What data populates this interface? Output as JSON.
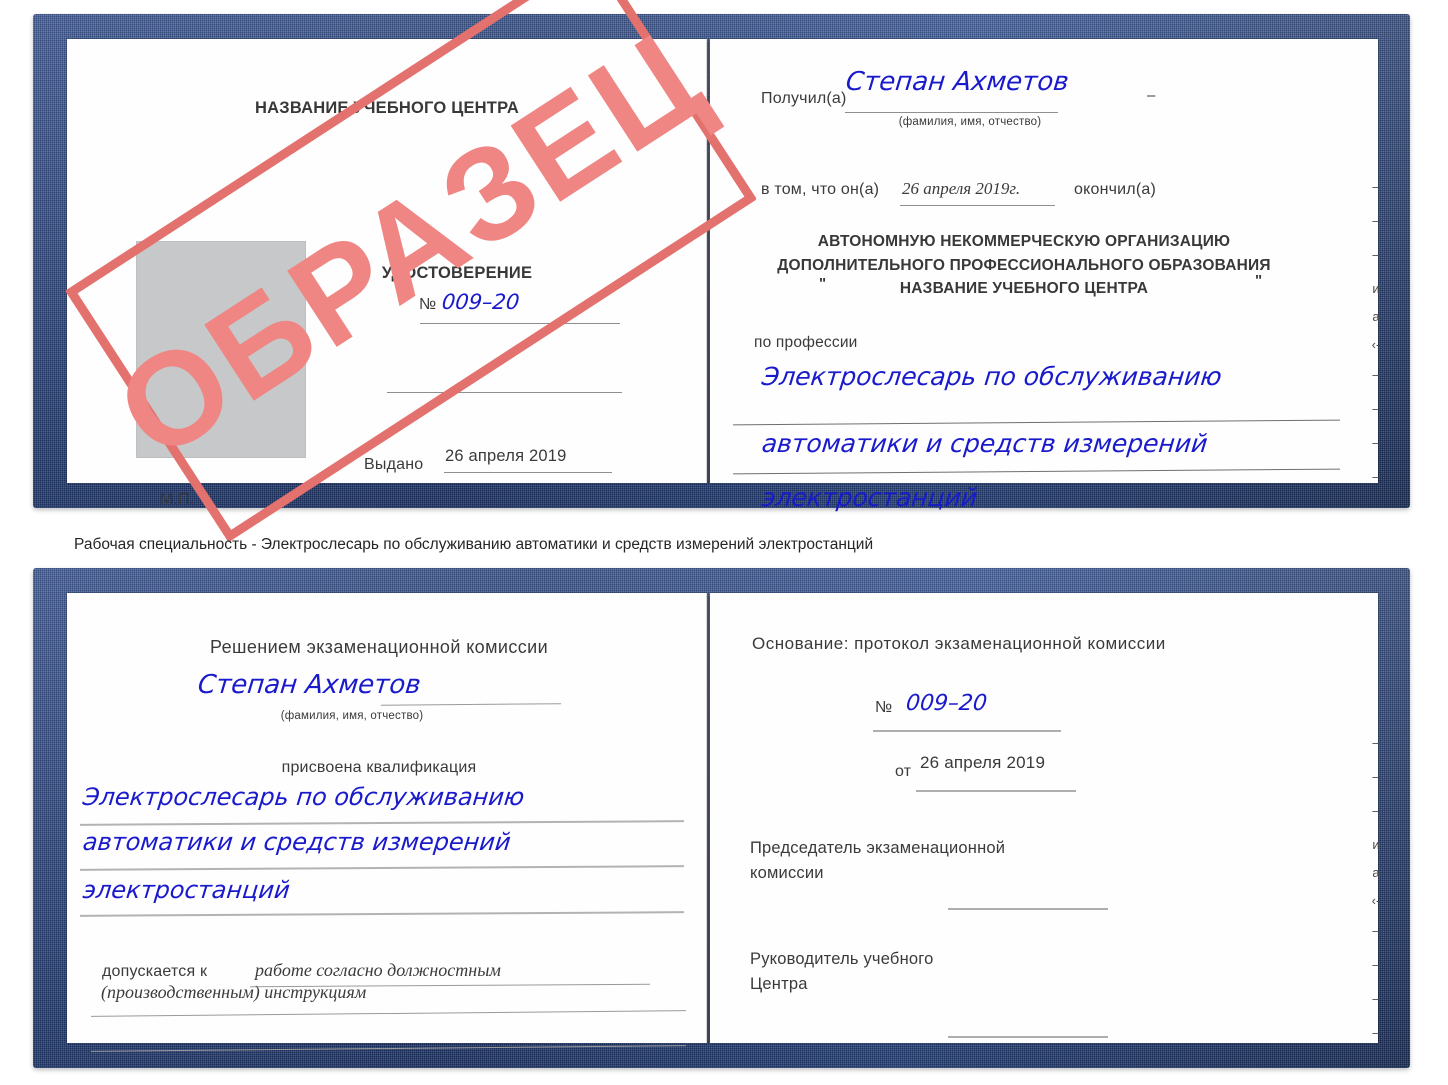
{
  "caption": {
    "text": "Рабочая специальность - Электрослесарь по обслуживанию автоматики и средств измерений электростанций"
  },
  "stamp": {
    "label": "ОБРАЗЕЦ",
    "color": "#ef8683",
    "border_color": "#e3716d"
  },
  "colors": {
    "cover_blue": "#2b4a8e",
    "handwriting_blue": "#1a1acd",
    "paper": "#fefefe",
    "photo_placeholder": "#c6c8c9",
    "text_gray": "#3a3a3a"
  },
  "certificate_top": {
    "left_page": {
      "heading": "НАЗВАНИЕ УЧЕБНОГО ЦЕНТРА",
      "doc_title": "УДОСТОВЕРЕНИЕ",
      "number_label": "№",
      "number_value": "009–20",
      "issued_label": "Выдано",
      "issued_value": "26 апреля 2019",
      "seal_label": "М.П."
    },
    "right_page": {
      "received_label": "Получил(а)",
      "received_value": "Степан Ахметов",
      "name_hint": "(фамилия, имя, отчество)",
      "that_he_label": "в том, что он(а)",
      "that_he_value": "26 апреля 2019г.",
      "finished_label": "окончил(а)",
      "org_line1": "АВТОНОМНУЮ НЕКОММЕРЧЕСКУЮ ОРГАНИЗАЦИЮ",
      "org_line2": "ДОПОЛНИТЕЛЬНОГО ПРОФЕССИОНАЛЬНОГО ОБРАЗОВАНИЯ",
      "org_quote_open": "\"",
      "org_line3": "НАЗВАНИЕ УЧЕБНОГО ЦЕНТРА",
      "org_quote_close": "\"",
      "profession_label": "по профессии",
      "profession_line1": "Электрослесарь по обслуживанию",
      "profession_line2": "автоматики и средств измерений",
      "profession_line3": "электростанций"
    },
    "edge_marks": [
      "–",
      "–",
      "–",
      "и",
      "а",
      "‹-",
      "–",
      "–",
      "–",
      "–"
    ]
  },
  "certificate_bottom": {
    "left_page": {
      "decision_heading": "Решением экзаменационной комиссии",
      "name_value": "Степан Ахметов",
      "name_hint": "(фамилия, имя, отчество)",
      "qualification_label": "присвоена квалификация",
      "qualification_line1": "Электрослесарь по обслуживанию",
      "qualification_line2": "автоматики и средств измерений",
      "qualification_line3": "электростанций",
      "admitted_label": "допускается к",
      "admitted_value_line1": "работе согласно должностным",
      "admitted_value_line2": "(производственным) инструкциям"
    },
    "right_page": {
      "basis_label": "Основание: протокол экзаменационной комиссии",
      "number_label": "№",
      "number_value": "009–20",
      "date_label": "от",
      "date_value": "26 апреля 2019",
      "chairman_line1": "Председатель экзаменационной",
      "chairman_line2": "комиссии",
      "head_line1": "Руководитель учебного",
      "head_line2": "Центра"
    },
    "edge_marks": [
      "–",
      "–",
      "–",
      "и",
      "а",
      "‹-",
      "–",
      "–",
      "–",
      "–"
    ]
  }
}
